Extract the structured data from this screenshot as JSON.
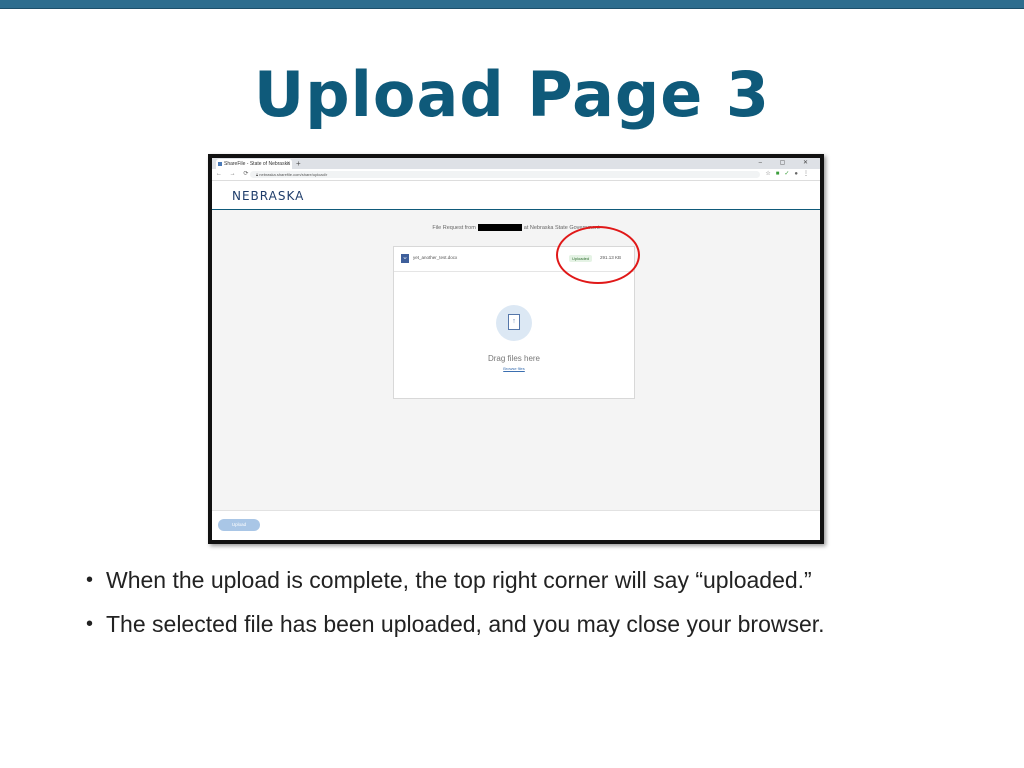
{
  "slide": {
    "title": "Upload Page 3",
    "bullets": [
      "When the upload is complete, the top right corner will say “uploaded.”",
      "The selected file has been uploaded, and you may close your browser."
    ]
  },
  "colors": {
    "title": "#0f5a7a",
    "highlight_ring": "#e01818",
    "upload_button": "#a9c6e6"
  },
  "browser": {
    "tab_title": "ShareFile - State of Nebraska",
    "new_tab_symbol": "+",
    "url": "nebraska.sharefile.com/share/upload/r",
    "window_controls": "– ▢ ✕"
  },
  "page": {
    "logo": "NEBRASKA",
    "request_prefix": "File Request from",
    "request_suffix": "at Nebraska State Government",
    "file": {
      "name": "yet_another_test.docx",
      "status": "Uploaded",
      "size": "291.13 KB"
    },
    "drop_zone": {
      "label": "Drag files here",
      "browse": "Browse files"
    },
    "upload_button": "Upload"
  }
}
